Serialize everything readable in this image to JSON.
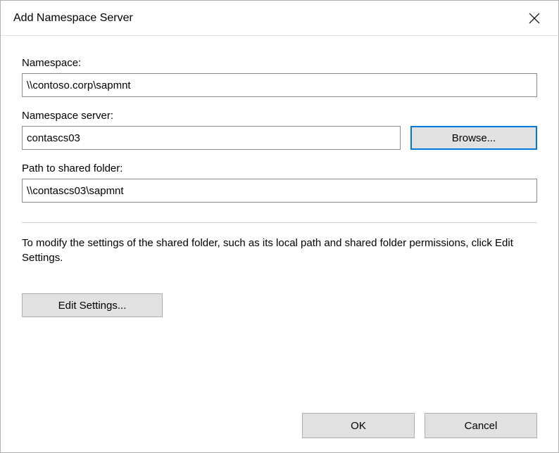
{
  "window": {
    "title": "Add Namespace Server"
  },
  "fields": {
    "namespace": {
      "label": "Namespace:",
      "value": "\\\\contoso.corp\\sapmnt"
    },
    "server": {
      "label": "Namespace server:",
      "value": "contascs03",
      "browse": "Browse..."
    },
    "path": {
      "label": "Path to shared folder:",
      "value": "\\\\contascs03\\sapmnt"
    }
  },
  "help_text": "To modify the settings of the shared folder, such as its local path and shared folder permissions, click Edit Settings.",
  "buttons": {
    "edit_settings": "Edit Settings...",
    "ok": "OK",
    "cancel": "Cancel"
  }
}
